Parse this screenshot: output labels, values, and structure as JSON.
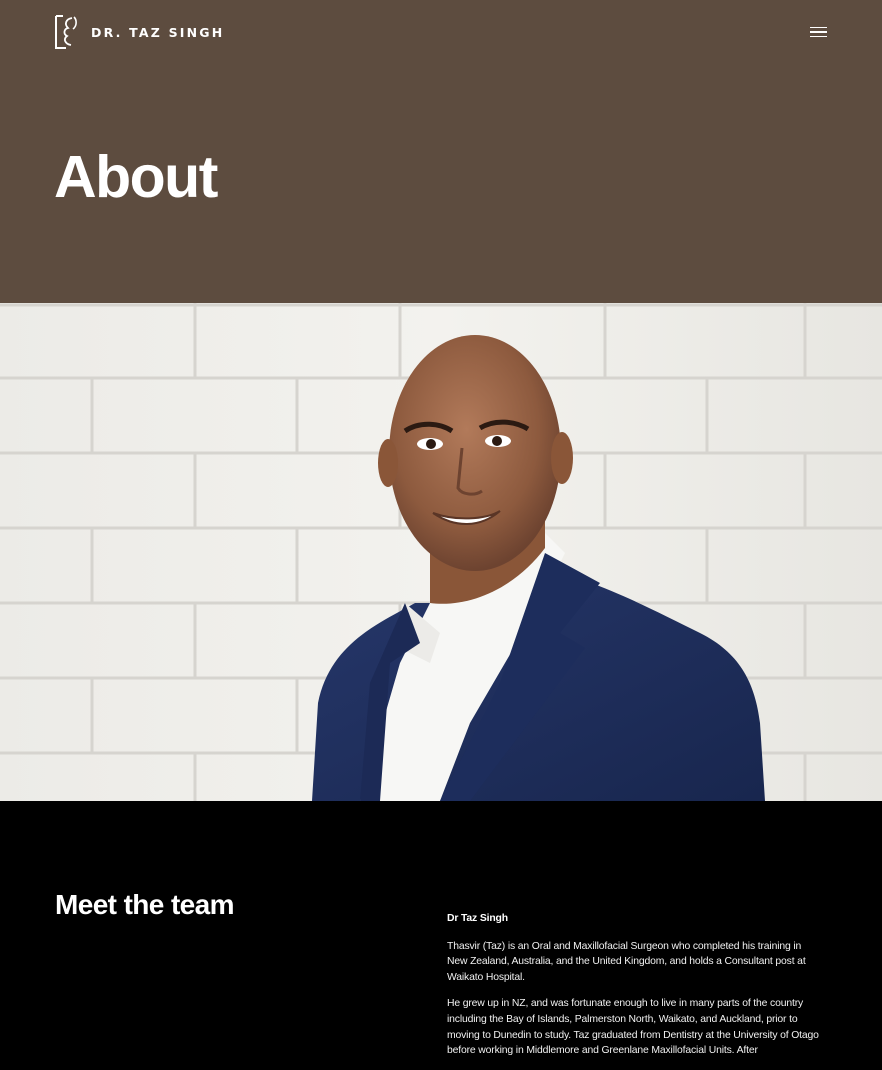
{
  "header": {
    "logo_text": "DR. TAZ SINGH",
    "menu_icon": "hamburger-icon",
    "background_color": "#5d4c3f"
  },
  "hero": {
    "title": "About"
  },
  "portrait": {
    "alt": "Portrait of Dr Taz Singh in a navy suit against a white brick wall"
  },
  "team": {
    "heading": "Meet the team",
    "member_name": "Dr Taz Singh",
    "paragraphs": [
      "Thasvir (Taz) is an Oral and Maxillofacial Surgeon who completed his training in New Zealand, Australia, and the United Kingdom, and holds a Consultant post at Waikato Hospital.",
      "He grew up in NZ, and was fortunate enough to live in many parts of the country including the Bay of Islands, Palmerston North, Waikato, and Auckland, prior to moving to Dunedin to study. Taz graduated from Dentistry at the University of Otago before working in Middlemore and Greenlane Maxillofacial Units. After"
    ]
  },
  "colors": {
    "brand_brown": "#5d4c3f",
    "section_black": "#000000",
    "suit_navy": "#1f3060"
  }
}
